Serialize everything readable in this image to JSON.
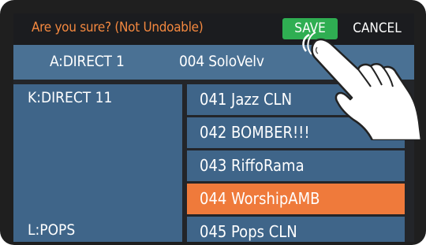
{
  "dialog": {
    "prompt": "Are you sure?  (Not Undoable)",
    "save_label": "SAVE",
    "cancel_label": "CANCEL"
  },
  "current_patch": {
    "bank": "A:DIRECT 1",
    "name": "004 SoloVelv"
  },
  "banks": [
    {
      "label": "K:DIRECT 11"
    },
    {
      "label": "L:POPS"
    }
  ],
  "patch_list": [
    {
      "label": "041 Jazz CLN"
    },
    {
      "label": "042 BOMBER!!!"
    },
    {
      "label": "043 RiffoRama"
    },
    {
      "label": "044 WorshipAMB",
      "selected": true
    },
    {
      "label": "045 Pops CLN"
    }
  ],
  "colors": {
    "prompt": "#f3883f",
    "save_button": "#2fae52",
    "panel": "#3f6589",
    "selected": "#ef7a3b"
  }
}
